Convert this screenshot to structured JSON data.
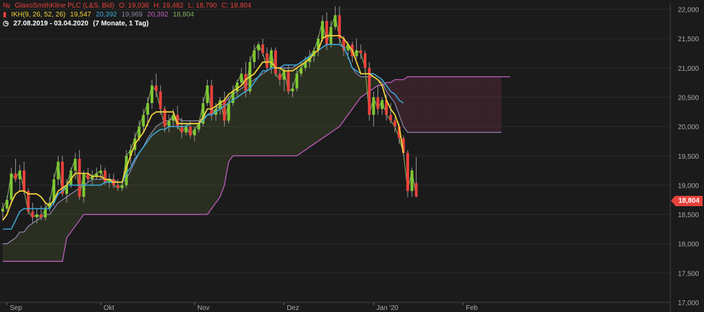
{
  "legend": {
    "instrument": {
      "name": "GlaxoSmithKline PLC (L&S, Bid)",
      "open": "O: 19,036",
      "high": "H: 19,482",
      "low": "L: 18,790",
      "close": "C: 18,804",
      "color": "#e8423c"
    },
    "indicator": {
      "label": "IKH(9, 26, 52, 26)",
      "v1": "19,547",
      "v2": "20,392",
      "v3": "19,969",
      "v4": "20,392",
      "v5": "18,804",
      "colors": [
        "#f5d33a",
        "#3fa9d8",
        "#8b86a8",
        "#c05fc0",
        "#7fae5a"
      ]
    },
    "range": {
      "dates": "27.08.2019 - 03.04.2020",
      "period": "(7 Monate, 1 Tag)"
    }
  },
  "last_price_badge": "18,804",
  "chart_data": {
    "type": "candlestick",
    "title": "GlaxoSmithKline PLC (L&S, Bid)",
    "x_tick_labels": [
      "Sep",
      "Okt",
      "Nov",
      "Dez",
      "Jan '20",
      "Feb"
    ],
    "x_tick_index": [
      1,
      23,
      45,
      66,
      87,
      108
    ],
    "y_ticks": [
      "22,000",
      "21,500",
      "21,000",
      "20,500",
      "20,000",
      "19,500",
      "19,000",
      "18,500",
      "18,000",
      "17,500",
      "17,000"
    ],
    "ylim": [
      17.0,
      22.1
    ],
    "colors": {
      "up": "#7ec832",
      "down": "#e8423c",
      "tenkan": "#f5d33a",
      "kijun": "#3fa9d8",
      "spanA": "#8b86a8",
      "spanB": "#c05fc0",
      "chikou": "#7fae5a"
    },
    "candles": [
      [
        18.55,
        18.7,
        18.4,
        18.6
      ],
      [
        18.6,
        18.82,
        18.55,
        18.75
      ],
      [
        18.75,
        19.3,
        18.7,
        19.2
      ],
      [
        19.2,
        19.45,
        19.05,
        19.1
      ],
      [
        19.1,
        19.35,
        18.9,
        19.25
      ],
      [
        19.25,
        19.4,
        18.85,
        18.9
      ],
      [
        18.9,
        18.95,
        18.5,
        18.55
      ],
      [
        18.55,
        18.7,
        18.35,
        18.45
      ],
      [
        18.45,
        18.6,
        18.35,
        18.5
      ],
      [
        18.5,
        18.65,
        18.4,
        18.45
      ],
      [
        18.45,
        18.7,
        18.4,
        18.6
      ],
      [
        18.6,
        18.8,
        18.55,
        18.7
      ],
      [
        18.7,
        19.2,
        18.65,
        19.1
      ],
      [
        19.1,
        19.5,
        19.0,
        19.4
      ],
      [
        19.4,
        19.5,
        18.8,
        18.85
      ],
      [
        18.85,
        19.1,
        18.7,
        19.0
      ],
      [
        19.0,
        19.3,
        18.95,
        19.25
      ],
      [
        19.25,
        19.55,
        19.1,
        19.45
      ],
      [
        19.45,
        19.6,
        18.75,
        18.8
      ],
      [
        18.8,
        19.25,
        18.7,
        19.2
      ],
      [
        19.2,
        19.3,
        19.05,
        19.1
      ],
      [
        19.1,
        19.25,
        19.0,
        19.15
      ],
      [
        19.15,
        19.3,
        19.1,
        19.2
      ],
      [
        19.2,
        19.35,
        19.1,
        19.25
      ],
      [
        19.25,
        19.3,
        19.0,
        19.05
      ],
      [
        19.05,
        19.2,
        18.95,
        19.1
      ],
      [
        19.1,
        19.2,
        18.95,
        19.0
      ],
      [
        19.0,
        19.1,
        18.9,
        18.95
      ],
      [
        18.95,
        19.05,
        18.9,
        19.0
      ],
      [
        19.0,
        19.6,
        18.95,
        19.5
      ],
      [
        19.5,
        19.7,
        19.35,
        19.6
      ],
      [
        19.6,
        19.9,
        19.5,
        19.8
      ],
      [
        19.8,
        20.1,
        19.75,
        20.0
      ],
      [
        20.0,
        20.3,
        19.9,
        20.2
      ],
      [
        20.2,
        20.5,
        20.0,
        20.4
      ],
      [
        20.4,
        20.8,
        20.3,
        20.7
      ],
      [
        20.7,
        20.9,
        20.5,
        20.6
      ],
      [
        20.6,
        20.7,
        20.2,
        20.3
      ],
      [
        20.3,
        20.35,
        19.9,
        20.0
      ],
      [
        20.0,
        20.2,
        19.9,
        20.1
      ],
      [
        20.1,
        20.3,
        20.0,
        20.2
      ],
      [
        20.2,
        20.35,
        19.95,
        20.0
      ],
      [
        20.0,
        20.15,
        19.8,
        19.9
      ],
      [
        19.9,
        20.05,
        19.85,
        20.0
      ],
      [
        20.0,
        20.1,
        19.8,
        19.85
      ],
      [
        19.85,
        20.0,
        19.75,
        19.95
      ],
      [
        19.95,
        20.1,
        19.9,
        20.05
      ],
      [
        20.05,
        20.5,
        20.0,
        20.4
      ],
      [
        20.4,
        20.8,
        20.35,
        20.7
      ],
      [
        20.7,
        20.8,
        20.1,
        20.2
      ],
      [
        20.2,
        20.4,
        20.1,
        20.3
      ],
      [
        20.3,
        20.5,
        20.2,
        20.45
      ],
      [
        20.45,
        20.6,
        20.0,
        20.1
      ],
      [
        20.1,
        20.5,
        20.05,
        20.4
      ],
      [
        20.4,
        20.7,
        20.35,
        20.6
      ],
      [
        20.6,
        20.8,
        20.5,
        20.75
      ],
      [
        20.75,
        21.0,
        20.7,
        20.9
      ],
      [
        20.9,
        21.1,
        20.5,
        20.6
      ],
      [
        20.6,
        21.2,
        20.55,
        21.1
      ],
      [
        21.1,
        21.4,
        21.0,
        21.3
      ],
      [
        21.3,
        21.45,
        21.15,
        21.4
      ],
      [
        21.4,
        21.5,
        21.2,
        21.25
      ],
      [
        21.25,
        21.35,
        20.95,
        21.0
      ],
      [
        21.0,
        21.35,
        20.9,
        21.3
      ],
      [
        21.3,
        21.35,
        20.85,
        20.9
      ],
      [
        20.9,
        21.0,
        20.7,
        20.8
      ],
      [
        20.8,
        21.0,
        20.6,
        20.95
      ],
      [
        20.95,
        21.05,
        20.55,
        20.6
      ],
      [
        20.6,
        20.75,
        20.5,
        20.65
      ],
      [
        20.65,
        21.0,
        20.6,
        20.9
      ],
      [
        20.9,
        21.1,
        20.85,
        21.0
      ],
      [
        21.0,
        21.2,
        20.95,
        21.1
      ],
      [
        21.1,
        21.3,
        21.0,
        21.2
      ],
      [
        21.2,
        21.35,
        21.1,
        21.3
      ],
      [
        21.3,
        21.55,
        21.2,
        21.5
      ],
      [
        21.5,
        21.9,
        21.45,
        21.8
      ],
      [
        21.8,
        21.95,
        21.3,
        21.4
      ],
      [
        21.4,
        21.8,
        21.35,
        21.7
      ],
      [
        21.7,
        22.05,
        21.65,
        21.9
      ],
      [
        21.9,
        22.05,
        21.4,
        21.5
      ],
      [
        21.5,
        21.55,
        21.2,
        21.3
      ],
      [
        21.3,
        21.45,
        21.15,
        21.4
      ],
      [
        21.4,
        21.45,
        21.1,
        21.2
      ],
      [
        21.2,
        21.5,
        21.15,
        21.3
      ],
      [
        21.3,
        21.4,
        21.15,
        21.25
      ],
      [
        21.25,
        21.3,
        20.95,
        21.0
      ],
      [
        21.0,
        21.1,
        20.1,
        20.2
      ],
      [
        20.2,
        20.6,
        20.0,
        20.5
      ],
      [
        20.5,
        20.7,
        20.2,
        20.3
      ],
      [
        20.3,
        20.5,
        20.2,
        20.45
      ],
      [
        20.45,
        20.55,
        20.1,
        20.2
      ],
      [
        20.2,
        20.4,
        20.05,
        20.1
      ],
      [
        20.1,
        20.15,
        19.9,
        20.0
      ],
      [
        20.0,
        20.05,
        19.7,
        19.8
      ],
      [
        19.8,
        19.85,
        19.5,
        19.55
      ],
      [
        19.55,
        19.6,
        18.8,
        18.9
      ],
      [
        18.9,
        19.3,
        18.8,
        19.25
      ],
      [
        19.036,
        19.482,
        18.79,
        18.804
      ]
    ],
    "tenkan": [
      18.4,
      18.5,
      18.7,
      18.85,
      18.9,
      18.9,
      18.85,
      18.85,
      18.85,
      18.8,
      18.7,
      18.65,
      18.75,
      18.9,
      18.95,
      19.0,
      19.1,
      19.2,
      19.2,
      19.2,
      19.2,
      19.15,
      19.15,
      19.15,
      19.1,
      19.1,
      19.05,
      19.05,
      19.05,
      19.3,
      19.5,
      19.7,
      19.8,
      19.9,
      20.05,
      20.2,
      20.25,
      20.25,
      20.25,
      20.25,
      20.25,
      20.05,
      20.05,
      20.05,
      20.05,
      20.05,
      20.05,
      20.15,
      20.3,
      20.3,
      20.35,
      20.4,
      20.45,
      20.55,
      20.6,
      20.65,
      20.7,
      20.8,
      20.85,
      20.9,
      21.0,
      21.1,
      21.1,
      21.1,
      21.0,
      21.0,
      20.95,
      20.95,
      20.95,
      21.0,
      21.05,
      21.1,
      21.15,
      21.25,
      21.3,
      21.5,
      21.55,
      21.55,
      21.55,
      21.55,
      21.5,
      21.4,
      21.3,
      21.1,
      20.9,
      20.9,
      20.9,
      20.85,
      20.8,
      20.7,
      20.45,
      20.3,
      20.2,
      20.0,
      19.55
    ],
    "kijun": [
      18.25,
      18.25,
      18.25,
      18.4,
      18.55,
      18.6,
      18.6,
      18.6,
      18.6,
      18.6,
      18.6,
      18.6,
      18.7,
      18.85,
      18.9,
      19.0,
      19.0,
      19.0,
      19.0,
      19.0,
      19.0,
      19.0,
      19.0,
      19.0,
      19.05,
      19.05,
      19.05,
      19.05,
      19.05,
      19.2,
      19.3,
      19.45,
      19.55,
      19.65,
      19.75,
      19.85,
      19.9,
      19.95,
      19.95,
      20.0,
      20.0,
      20.0,
      20.0,
      20.0,
      20.05,
      20.05,
      20.05,
      20.1,
      20.2,
      20.2,
      20.25,
      20.3,
      20.35,
      20.4,
      20.45,
      20.5,
      20.55,
      20.6,
      20.65,
      20.75,
      20.85,
      20.95,
      20.95,
      21.0,
      21.0,
      21.0,
      21.05,
      21.05,
      21.05,
      21.05,
      21.1,
      21.15,
      21.2,
      21.25,
      21.3,
      21.35,
      21.4,
      21.4,
      21.4,
      21.4,
      21.35,
      21.2,
      21.0,
      20.95,
      20.9,
      20.9,
      20.9,
      20.9,
      20.85,
      20.8,
      20.7,
      20.6,
      20.55,
      20.45,
      20.4
    ],
    "chikou": [
      18.6,
      18.75,
      19.2,
      19.1,
      19.25,
      18.9,
      18.55,
      18.45,
      18.5,
      18.45,
      18.6,
      18.7,
      19.1,
      19.4,
      18.85,
      19.0,
      19.25,
      19.45,
      18.8,
      19.2,
      19.1,
      19.15,
      19.2,
      19.25,
      19.05,
      19.1,
      19.0,
      18.95,
      19.0,
      19.5,
      19.6,
      19.8,
      20.0,
      20.2,
      20.4,
      20.7,
      20.6,
      20.3,
      20.0,
      20.1,
      20.2,
      20.0,
      19.9,
      20.0,
      19.85,
      19.95,
      20.05,
      20.4,
      20.7,
      20.2,
      20.3,
      20.45,
      20.1,
      20.4,
      20.6,
      20.75,
      20.9,
      20.6,
      21.1,
      21.3,
      21.4,
      21.25,
      21.0,
      21.3,
      20.9,
      20.8,
      20.95,
      20.6,
      20.65,
      20.9,
      21.0,
      21.1,
      21.2,
      21.3,
      21.5,
      21.8,
      21.4,
      21.7,
      21.9,
      21.5,
      21.3,
      21.4,
      21.2,
      21.3,
      21.25,
      21.0,
      20.2,
      20.5,
      20.3,
      20.45,
      20.2,
      20.1,
      20.0,
      19.8,
      19.55,
      18.9,
      19.25,
      18.804
    ],
    "span_a": [
      18.0,
      18.0,
      18.05,
      18.1,
      18.2,
      18.2,
      18.3,
      18.35,
      18.4,
      18.45,
      18.5,
      18.5,
      18.6,
      18.7,
      18.75,
      18.8,
      18.85,
      18.9,
      18.95,
      19.0,
      19.05,
      19.1,
      19.1,
      19.1,
      19.1,
      19.1,
      19.1,
      19.05,
      19.05,
      19.1,
      19.25,
      19.4,
      19.55,
      19.65,
      19.8,
      19.9,
      20.0,
      20.05,
      20.1,
      20.1,
      20.15,
      20.15,
      20.1,
      20.1,
      20.1,
      20.1,
      20.1,
      20.15,
      20.2,
      20.25,
      20.3,
      20.35,
      20.4,
      20.5,
      20.55,
      20.6,
      20.65,
      20.7,
      20.75,
      20.8,
      20.85,
      20.9,
      20.95,
      21.0,
      21.0,
      21.0,
      21.0,
      21.0,
      21.0,
      21.05,
      21.1,
      21.15,
      21.2,
      21.25,
      21.3,
      21.35,
      21.4,
      21.4,
      21.4,
      21.4,
      21.35,
      21.2,
      21.0,
      20.9,
      20.85,
      20.85,
      20.85,
      20.85,
      20.8,
      20.75,
      20.6,
      20.5,
      20.4,
      20.2,
      20.0,
      19.9,
      19.9,
      19.9,
      19.9,
      19.9,
      19.9,
      19.9,
      19.9,
      19.9,
      19.9,
      19.9,
      19.9,
      19.9,
      19.9,
      19.9,
      19.9,
      19.9,
      19.9,
      19.9,
      19.9,
      19.9,
      19.9,
      19.9
    ],
    "span_b": [
      17.7,
      17.7,
      17.7,
      17.7,
      17.7,
      17.7,
      17.7,
      17.7,
      17.7,
      17.7,
      17.7,
      17.7,
      17.7,
      17.7,
      17.7,
      18.1,
      18.2,
      18.3,
      18.4,
      18.5,
      18.5,
      18.5,
      18.5,
      18.5,
      18.5,
      18.5,
      18.5,
      18.5,
      18.5,
      18.5,
      18.5,
      18.5,
      18.5,
      18.5,
      18.5,
      18.5,
      18.5,
      18.5,
      18.5,
      18.5,
      18.5,
      18.5,
      18.5,
      18.5,
      18.5,
      18.5,
      18.5,
      18.5,
      18.5,
      18.6,
      18.7,
      18.8,
      19.0,
      19.4,
      19.5,
      19.5,
      19.5,
      19.5,
      19.5,
      19.5,
      19.5,
      19.5,
      19.5,
      19.5,
      19.5,
      19.5,
      19.5,
      19.5,
      19.5,
      19.5,
      19.55,
      19.6,
      19.65,
      19.7,
      19.75,
      19.8,
      19.85,
      19.9,
      19.95,
      20.0,
      20.1,
      20.2,
      20.3,
      20.4,
      20.5,
      20.55,
      20.6,
      20.65,
      20.7,
      20.7,
      20.75,
      20.75,
      20.8,
      20.8,
      20.8,
      20.85,
      20.85,
      20.85,
      20.85,
      20.85,
      20.85,
      20.85,
      20.85,
      20.85,
      20.85,
      20.85,
      20.85,
      20.85,
      20.85,
      20.85,
      20.85,
      20.85,
      20.85,
      20.85,
      20.85,
      20.85,
      20.85,
      20.85,
      20.85,
      20.85
    ]
  }
}
